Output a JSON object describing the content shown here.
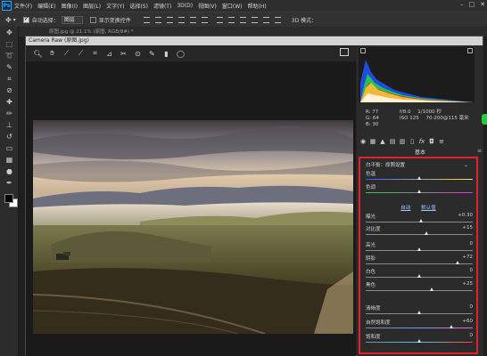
{
  "app": {
    "logo": "Ps",
    "menu": [
      "文件(F)",
      "编辑(E)",
      "图像(I)",
      "图层(L)",
      "文字(Y)",
      "选择(S)",
      "滤镜(T)",
      "3D(D)",
      "视图(V)",
      "窗口(W)",
      "帮助(H)"
    ],
    "win_min": "–",
    "win_max": "□",
    "win_close": "✕"
  },
  "options": {
    "auto_select_label": "自动选择：",
    "auto_select_value": "图层",
    "show_transform_label": "显示变换控件",
    "mode_3d": "3D 模式："
  },
  "document": {
    "tab_label": "原图.jpg @ 21.1% (原图, RGB/8#) *"
  },
  "camera_raw": {
    "title": "Camera Raw (原图.jpg)",
    "tools": [
      "zoom-icon",
      "hand-icon",
      "white-balance-icon",
      "color-sampler-icon",
      "crop-icon",
      "straighten-icon",
      "spot-removal-icon",
      "red-eye-icon",
      "adjustment-brush-icon",
      "graduated-filter-icon",
      "radial-filter-icon"
    ],
    "histogram": {
      "shadow_clip_label": "",
      "highlight_clip_label": ""
    },
    "readout": {
      "r": "R:  77",
      "g": "G:  64",
      "b": "B:  30"
    },
    "camera_info": {
      "aperture": "f/8.0",
      "shutter": "1/1000 秒",
      "iso": "ISO 125",
      "lens": "70-200@115 毫米"
    },
    "panel_tabs": [
      "basic-tab-icon",
      "tone-curve-tab-icon",
      "detail-tab-icon",
      "hsl-tab-icon",
      "split-toning-tab-icon",
      "lens-tab-icon",
      "effects-tab-icon",
      "fx-tab-icon",
      "camera-calibration-tab-icon",
      "presets-tab-icon"
    ],
    "panel_title": "基本",
    "white_balance": {
      "label": "白平衡：",
      "value": "原照设置"
    },
    "auto_label": "自动",
    "default_label": "默认值",
    "sliders": [
      {
        "label": "色温",
        "value": "",
        "level": 0.5
      },
      {
        "label": "色调",
        "value": "",
        "level": 0.5
      },
      {
        "label": "曝光",
        "value": "+0.30",
        "level": 0.52
      },
      {
        "label": "对比度",
        "value": "+15",
        "level": 0.57
      },
      {
        "label": "高光",
        "value": "0",
        "level": 0.5
      },
      {
        "label": "阴影",
        "value": "+72",
        "level": 0.86
      },
      {
        "label": "白色",
        "value": "0",
        "level": 0.5
      },
      {
        "label": "黑色",
        "value": "+25",
        "level": 0.62
      },
      {
        "label": "清晰度",
        "value": "0",
        "level": 0.5
      },
      {
        "label": "自然饱和度",
        "value": "+60",
        "level": 0.8
      },
      {
        "label": "饱和度",
        "value": "0",
        "level": 0.5
      }
    ],
    "accent_color": "#e0232a"
  }
}
